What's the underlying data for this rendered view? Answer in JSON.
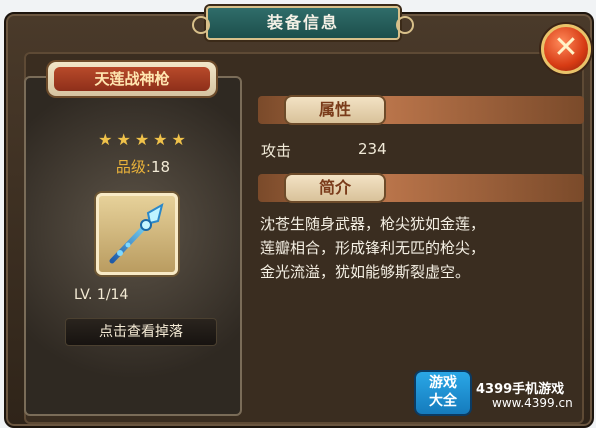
{
  "header": {
    "title": "装备信息"
  },
  "close": {
    "label": "✕"
  },
  "item_card": {
    "name": "天莲战神枪",
    "stars": "★★★★★",
    "grade_label": "品级:",
    "grade_value": "18",
    "level": "LV. 1/14",
    "drop_button": "点击查看掉落"
  },
  "attributes": {
    "section_label": "属性",
    "rows": [
      {
        "name": "攻击",
        "value": "234"
      }
    ]
  },
  "intro": {
    "section_label": "简介",
    "lines": [
      "沈苍生随身武器，枪尖犹如金莲，",
      "莲瓣相合，形成锋利无匹的枪尖，",
      "金光流溢，犹如能够斯裂虚空。"
    ]
  },
  "watermark": {
    "badge_top": "游戏",
    "badge_bottom": "大全",
    "text": "4399手机游戏",
    "sub": "www.4399.cn"
  }
}
